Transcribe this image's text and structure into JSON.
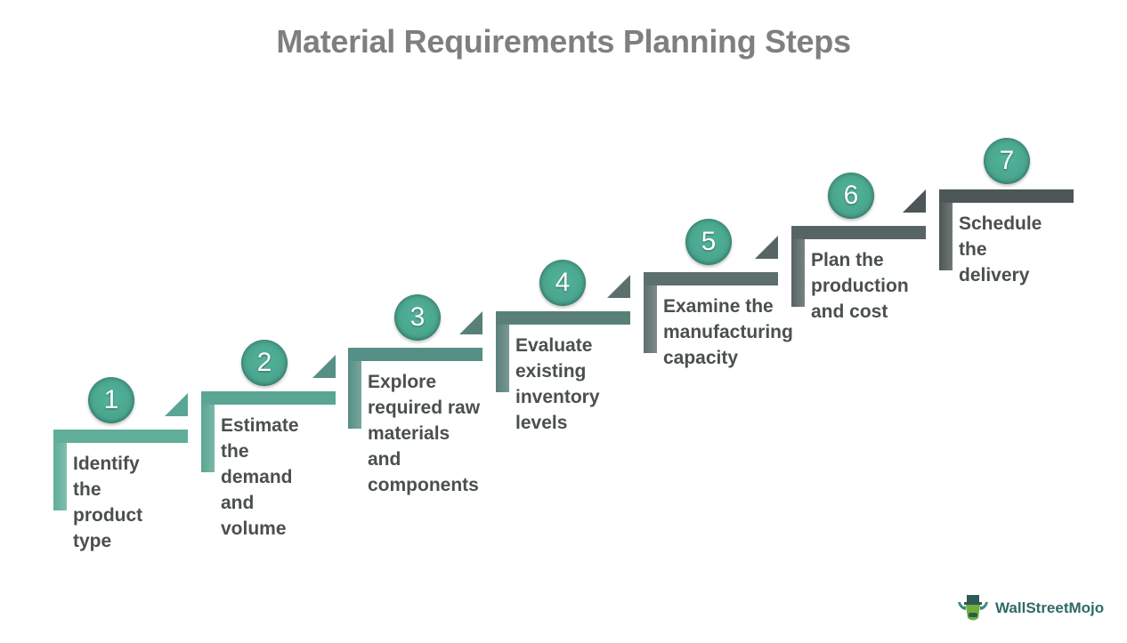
{
  "title": "Material Requirements Planning Steps",
  "steps": [
    {
      "number": "1",
      "label": "Identify\nthe\nproduct\ntype",
      "color": "#5fae9a"
    },
    {
      "number": "2",
      "label": "Estimate\nthe\ndemand\nand\nvolume",
      "color": "#5aa593"
    },
    {
      "number": "3",
      "label": "Explore\nrequired raw\nmaterials\nand\ncomponents",
      "color": "#568f85"
    },
    {
      "number": "4",
      "label": "Evaluate\nexisting\ninventory\nlevels",
      "color": "#5a7f79"
    },
    {
      "number": "5",
      "label": "Examine the\nmanufacturing\ncapacity",
      "color": "#5c6f6c"
    },
    {
      "number": "6",
      "label": "Plan the\nproduction\nand cost",
      "color": "#566563"
    },
    {
      "number": "7",
      "label": "Schedule\nthe\ndelivery",
      "color": "#4c5756"
    }
  ],
  "circle_color": "#4aa58e",
  "logo": {
    "text": "WallStreetMojo",
    "icon": "bull-mascot-icon"
  }
}
